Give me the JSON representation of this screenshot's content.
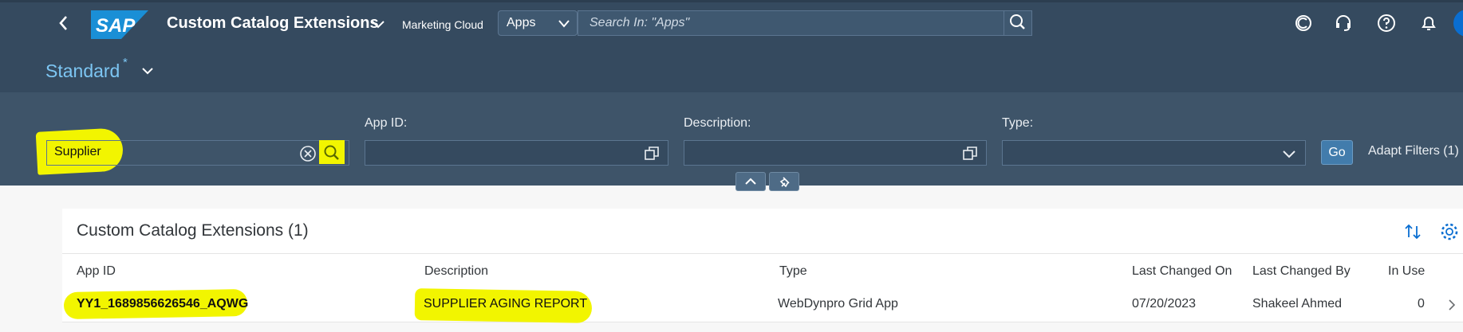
{
  "shell": {
    "app_title": "Custom Catalog Extensions",
    "system": "Marketing Cloud",
    "scope": "Apps",
    "search_placeholder": "Search In: \"Apps\"",
    "icons": [
      "back-icon",
      "sap-logo",
      "chevron-down-icon",
      "search-icon",
      "copilot-icon",
      "headset-icon",
      "help-icon",
      "bell-icon",
      "avatar"
    ]
  },
  "variant": {
    "name": "Standard",
    "modified_marker": "*"
  },
  "filters": {
    "search_value": "Supplier",
    "app_id_label": "App ID:",
    "app_id_value": "",
    "description_label": "Description:",
    "description_value": "",
    "type_label": "Type:",
    "type_value": "",
    "go_label": "Go",
    "adapt_label": "Adapt Filters (1)"
  },
  "table": {
    "title": "Custom Catalog Extensions (1)",
    "columns": [
      "App ID",
      "Description",
      "Type",
      "Last Changed On",
      "Last Changed By",
      "In Use"
    ],
    "rows": [
      {
        "app_id": "YY1_1689856626546_AQWG",
        "description": "SUPPLIER AGING REPORT",
        "type": "WebDynpro Grid App",
        "last_changed_on": "07/20/2023",
        "last_changed_by": "Shakeel Ahmed",
        "in_use": "0"
      }
    ]
  },
  "colors": {
    "shell": "#354a5f",
    "filterbar": "#3e5469",
    "variant": "#7dc6f3",
    "go": "#427cac",
    "highlight": "#f2f500"
  }
}
